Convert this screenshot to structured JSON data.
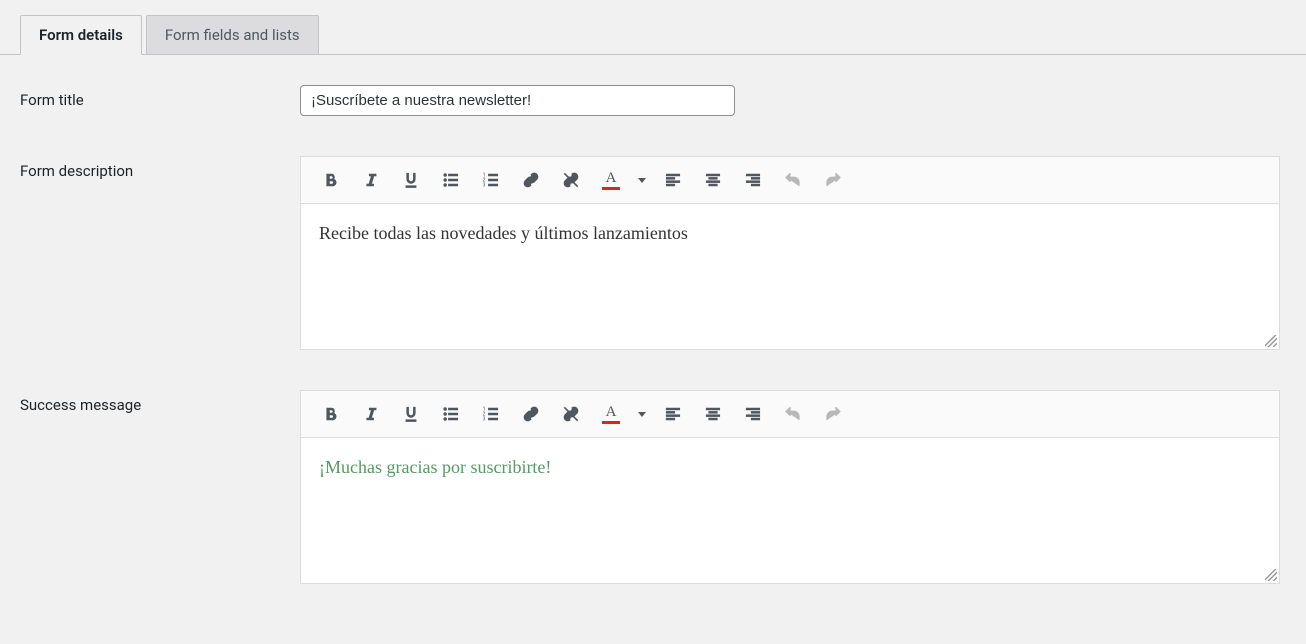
{
  "tabs": [
    {
      "label": "Form details",
      "active": true
    },
    {
      "label": "Form fields and lists",
      "active": false
    }
  ],
  "fields": {
    "title": {
      "label": "Form title",
      "value": "¡Suscríbete a nuestra newsletter!"
    },
    "description": {
      "label": "Form description",
      "content": "Recibe todas las novedades y últimos lanzamientos"
    },
    "success": {
      "label": "Success message",
      "content": "¡Muchas gracias por suscribirte!"
    }
  }
}
